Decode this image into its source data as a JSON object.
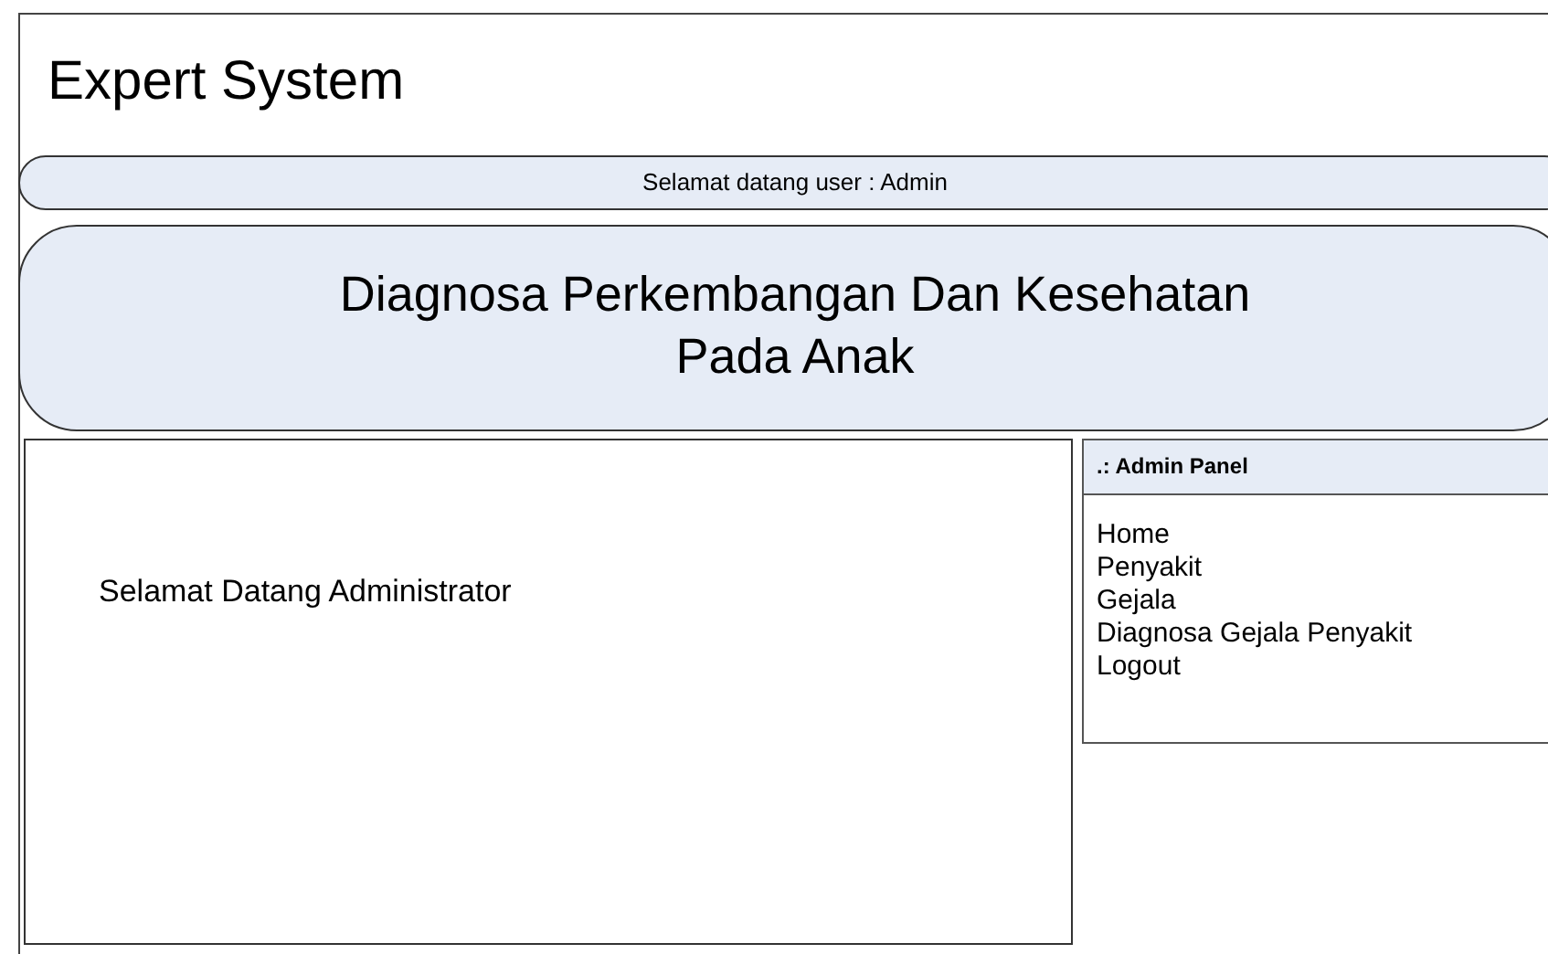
{
  "app_title": "Expert System",
  "welcome_bar": "Selamat datang user : Admin",
  "banner": [
    "Diagnosa Perkembangan Dan Kesehatan",
    "Pada Anak"
  ],
  "content": {
    "message": "Selamat Datang Administrator"
  },
  "admin_panel": {
    "title": ".: Admin Panel",
    "items": [
      {
        "label": "Home"
      },
      {
        "label": "Penyakit"
      },
      {
        "label": "Gejala"
      },
      {
        "label": "Diagnosa Gejala Penyakit"
      },
      {
        "label": "Logout"
      }
    ]
  }
}
